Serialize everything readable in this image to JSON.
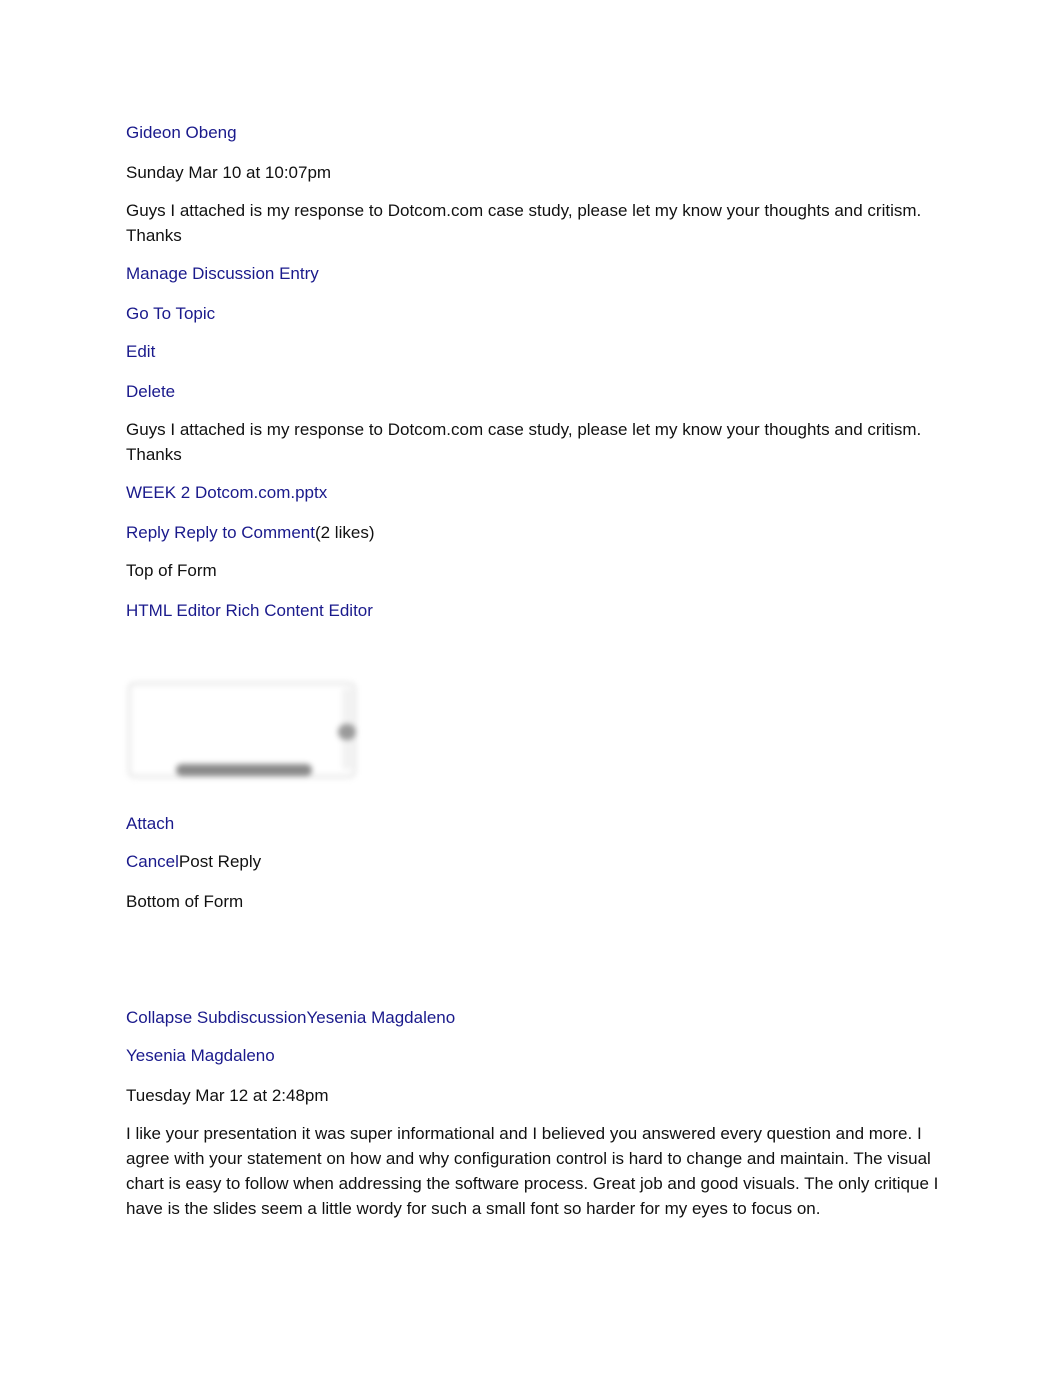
{
  "entry": {
    "author": "Gideon Obeng",
    "timestamp": "Sunday Mar 10 at 10:07pm",
    "message_line1": "Guys I attached is my response to Dotcom.com case study, please let my know your thoughts and critism.",
    "message_line2": "Thanks",
    "actions": {
      "manage": "Manage Discussion Entry",
      "go_to_topic": "Go To Topic",
      "edit": "Edit",
      "delete": "Delete"
    },
    "body_line1": "Guys I attached is my response to Dotcom.com case study, please let my know your thoughts and critism.",
    "body_line2": "Thanks",
    "attachment": "WEEK 2 Dotcom.com.pptx",
    "reply_link": "Reply Reply to Comment",
    "likes": "(2 likes)"
  },
  "reply_form": {
    "top_marker": "Top of Form",
    "editor_toggle": "HTML Editor Rich Content Editor",
    "editor_value": "",
    "attach": "Attach",
    "cancel": "Cancel",
    "post_reply": "Post Reply",
    "bottom_marker": "Bottom of Form"
  },
  "subdiscussion": {
    "collapse_link": "Collapse SubdiscussionYesenia Magdaleno",
    "author": "Yesenia Magdaleno",
    "timestamp": "Tuesday Mar 12 at 2:48pm",
    "message": "I like your presentation it was super informational and I believed you answered every question and more. I agree with your statement on how and why configuration control is hard to change and maintain. The visual chart is easy to follow when addressing the software process. Great job and good visuals. The only critique I have is the slides seem a little wordy for such a small font so harder for my eyes to focus on."
  },
  "colors": {
    "link": "#1a1a8c",
    "text": "#111111",
    "background": "#ffffff"
  }
}
